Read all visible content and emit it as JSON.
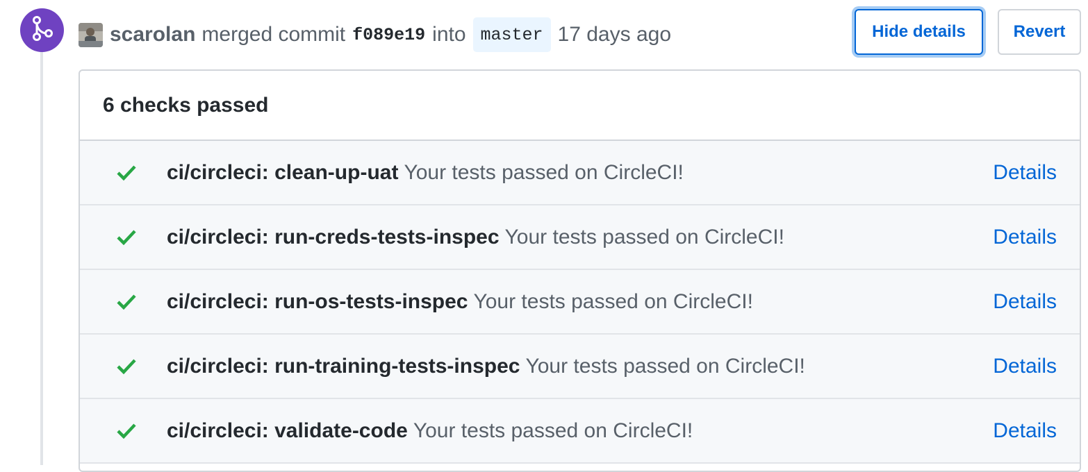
{
  "event": {
    "username": "scarolan",
    "merged_text": "merged commit",
    "commit_sha": "f089e19",
    "into_text": "into",
    "branch": "master",
    "time_ago": "17 days ago"
  },
  "buttons": {
    "hide_details": "Hide details",
    "revert": "Revert"
  },
  "checks": {
    "summary": "6 checks passed",
    "items": [
      {
        "name": "ci/circleci: clean-up-uat",
        "description": "Your tests passed on CircleCI!",
        "link": "Details",
        "status": "success"
      },
      {
        "name": "ci/circleci: run-creds-tests-inspec",
        "description": "Your tests passed on CircleCI!",
        "link": "Details",
        "status": "success"
      },
      {
        "name": "ci/circleci: run-os-tests-inspec",
        "description": "Your tests passed on CircleCI!",
        "link": "Details",
        "status": "success"
      },
      {
        "name": "ci/circleci: run-training-tests-inspec",
        "description": "Your tests passed on CircleCI!",
        "link": "Details",
        "status": "success"
      },
      {
        "name": "ci/circleci: validate-code",
        "description": "Your tests passed on CircleCI!",
        "link": "Details",
        "status": "success"
      }
    ]
  },
  "icons": {
    "merge": "git-merge-icon",
    "check": "check-icon",
    "avatar": "user-avatar"
  },
  "colors": {
    "merge_badge": "#6f42c1",
    "success": "#28a745",
    "link": "#0366d6"
  }
}
